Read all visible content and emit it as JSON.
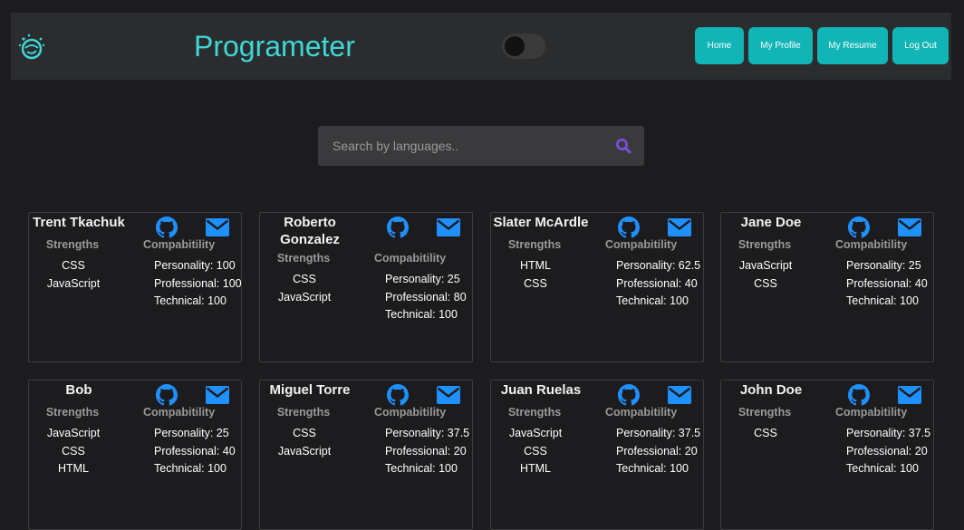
{
  "nav": {
    "brand": "Programeter",
    "buttons": [
      "Home",
      "My Profile",
      "My Resume",
      "Log Out"
    ]
  },
  "search": {
    "placeholder": "Search by languages.."
  },
  "labels": {
    "strengths": "Strengths",
    "compatibility": "Compabitility",
    "personality": "Personality:",
    "professional": "Professional:",
    "technical": "Technical:"
  },
  "developers": [
    {
      "name": "Trent Tkachuk",
      "strengths": [
        "CSS",
        "JavaScript"
      ],
      "personality": "100",
      "professional": "100",
      "technical": "100"
    },
    {
      "name": "Roberto Gonzalez",
      "strengths": [
        "CSS",
        "JavaScript"
      ],
      "personality": "25",
      "professional": "80",
      "technical": "100"
    },
    {
      "name": "Slater McArdle",
      "strengths": [
        "HTML",
        "CSS"
      ],
      "personality": "62.5",
      "professional": "40",
      "technical": "100"
    },
    {
      "name": "Jane Doe",
      "strengths": [
        "JavaScript",
        "CSS"
      ],
      "personality": "25",
      "professional": "40",
      "technical": "100"
    },
    {
      "name": "Bob",
      "strengths": [
        "JavaScript",
        "CSS",
        "HTML"
      ],
      "personality": "25",
      "professional": "40",
      "technical": "100"
    },
    {
      "name": "Miguel Torre",
      "strengths": [
        "CSS",
        "JavaScript"
      ],
      "personality": "37.5",
      "professional": "20",
      "technical": "100"
    },
    {
      "name": "Juan Ruelas",
      "strengths": [
        "JavaScript",
        "CSS",
        "HTML"
      ],
      "personality": "37.5",
      "professional": "20",
      "technical": "100"
    },
    {
      "name": "John Doe",
      "strengths": [
        "CSS"
      ],
      "personality": "37.5",
      "professional": "20",
      "technical": "100"
    }
  ],
  "colors": {
    "accent": "#12b5b5",
    "brand": "#3fd6d6",
    "icon_blue": "#1e90ff",
    "search_icon": "#7b4fe0"
  },
  "icons": {
    "logo": "brain-logo-icon",
    "search": "search-icon",
    "github": "github-icon",
    "email": "envelope-icon"
  }
}
